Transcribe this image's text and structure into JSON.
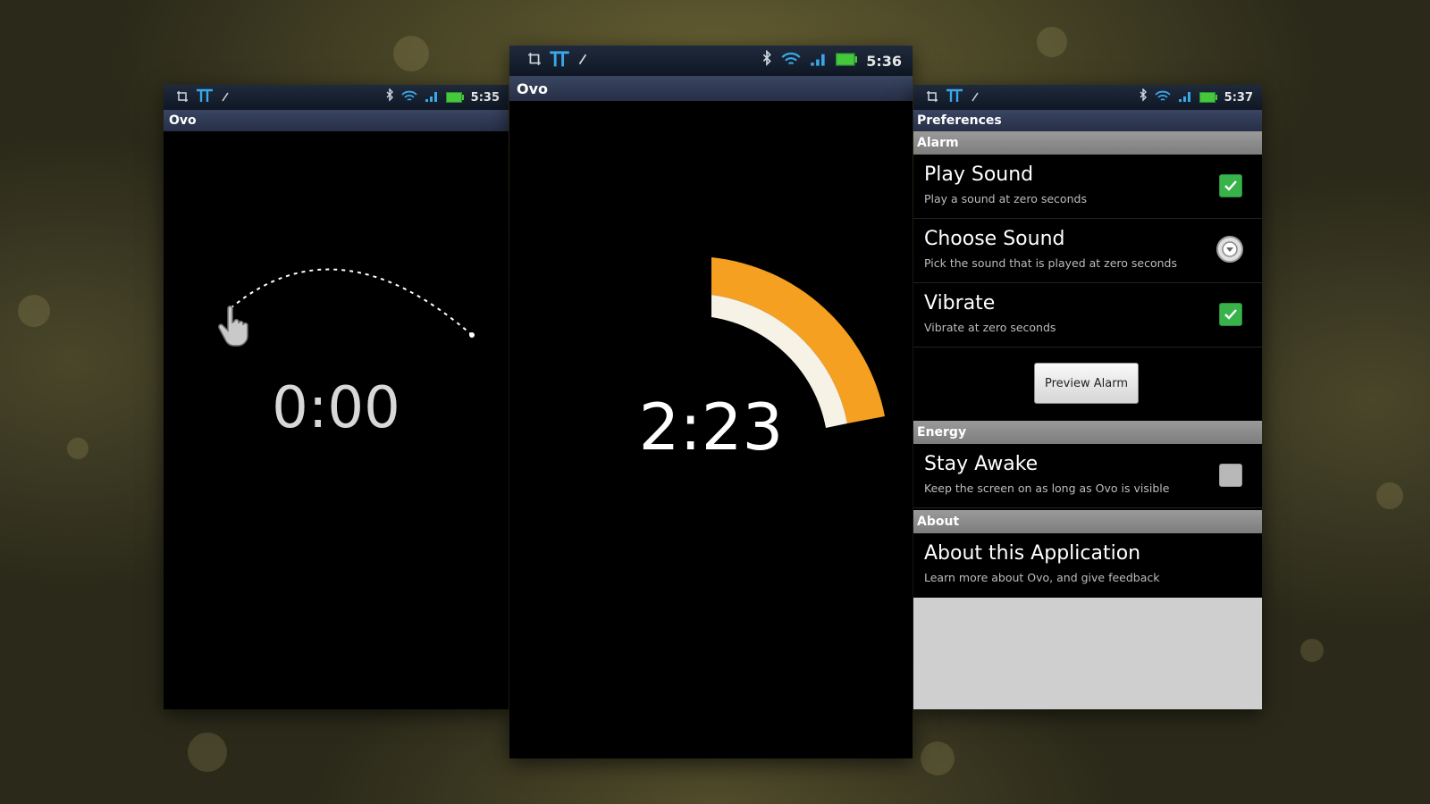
{
  "screens": {
    "left": {
      "status_time": "5:35",
      "app_title": "Ovo",
      "timer": "0:00"
    },
    "center": {
      "status_time": "5:36",
      "app_title": "Ovo",
      "timer": "2:23"
    },
    "right": {
      "status_time": "5:37",
      "title": "Preferences",
      "categories": {
        "alarm": "Alarm",
        "energy": "Energy",
        "about": "About"
      },
      "prefs": {
        "play_sound": {
          "title": "Play Sound",
          "summary": "Play a sound at zero seconds",
          "checked": true
        },
        "choose_sound": {
          "title": "Choose Sound",
          "summary": "Pick the sound that is played at zero seconds"
        },
        "vibrate": {
          "title": "Vibrate",
          "summary": "Vibrate at zero seconds",
          "checked": true
        },
        "stay_awake": {
          "title": "Stay Awake",
          "summary": "Keep the screen on as long as Ovo is visible",
          "checked": false
        },
        "about_app": {
          "title": "About this Application",
          "summary": "Learn more about Ovo, and give feedback"
        }
      },
      "preview_button": "Preview Alarm"
    }
  },
  "colors": {
    "accent_orange": "#f5a020",
    "inner_cream": "#f7f2e6",
    "checkbox_green": "#37b34a",
    "status_bar": "#18212f",
    "title_bar": "#303a54"
  },
  "icons": [
    "crop-icon",
    "t-mobile-icon",
    "pen-icon",
    "bluetooth-icon",
    "wifi-icon",
    "signal-icon",
    "battery-icon",
    "hand-pointer-icon",
    "dropdown-circle-icon",
    "check-icon"
  ]
}
